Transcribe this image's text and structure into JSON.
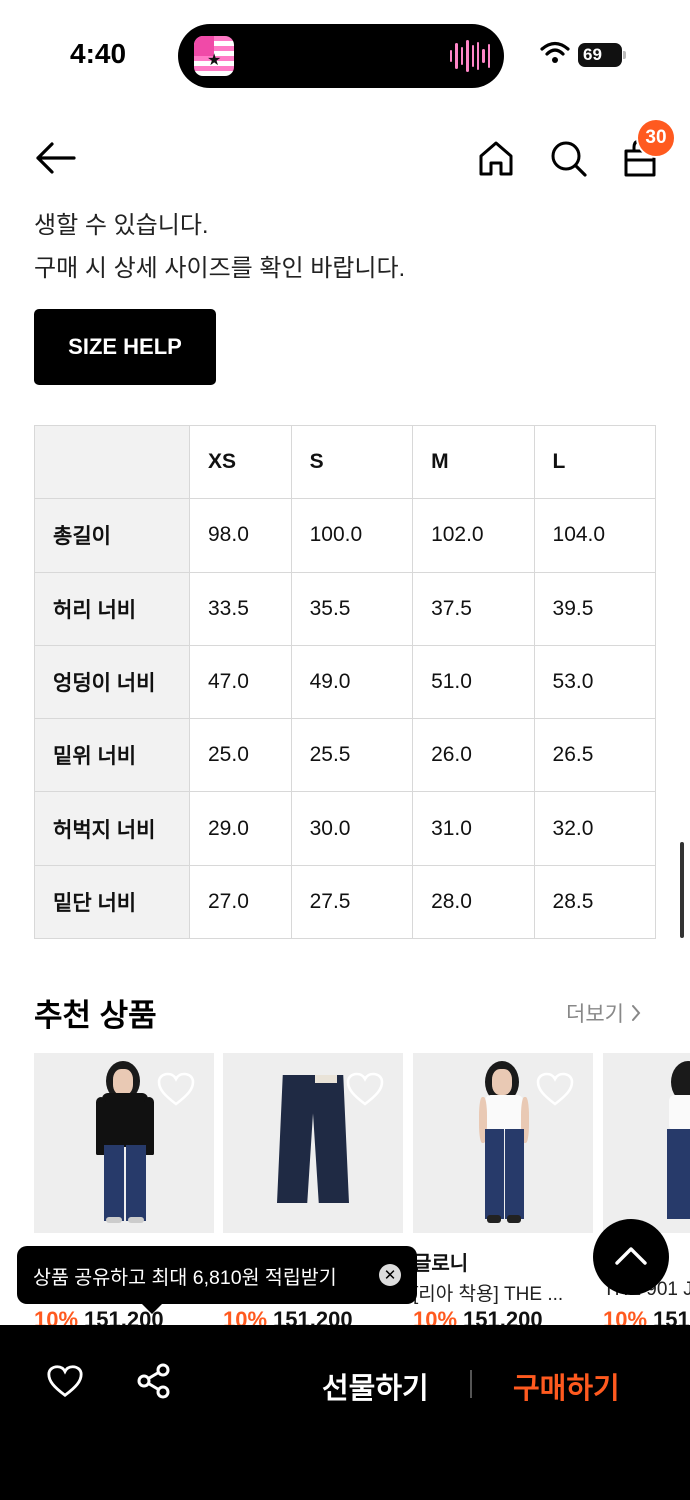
{
  "status_bar": {
    "time": "4:40",
    "battery": "69"
  },
  "nav": {
    "cart_count": "30"
  },
  "notes": {
    "line1": "생할 수 있습니다.",
    "line2": "구매 시 상세 사이즈를 확인 바랍니다."
  },
  "size_help_label": "SIZE HELP",
  "size_table": {
    "headers": [
      "",
      "XS",
      "S",
      "M",
      "L"
    ],
    "rows": [
      {
        "label": "총길이",
        "values": [
          "98.0",
          "100.0",
          "102.0",
          "104.0"
        ]
      },
      {
        "label": "허리 너비",
        "values": [
          "33.5",
          "35.5",
          "37.5",
          "39.5"
        ]
      },
      {
        "label": "엉덩이 너비",
        "values": [
          "47.0",
          "49.0",
          "51.0",
          "53.0"
        ]
      },
      {
        "label": "밑위 너비",
        "values": [
          "25.0",
          "25.5",
          "26.0",
          "26.5"
        ]
      },
      {
        "label": "허벅지 너비",
        "values": [
          "29.0",
          "30.0",
          "31.0",
          "32.0"
        ]
      },
      {
        "label": "밑단 너비",
        "values": [
          "27.0",
          "27.5",
          "28.0",
          "28.5"
        ]
      }
    ]
  },
  "recommended": {
    "title": "추천 상품",
    "more_label": "더보기",
    "products": [
      {
        "brand": "",
        "name": "",
        "discount": "10%",
        "price": "151,200"
      },
      {
        "brand": "",
        "name": "",
        "discount": "10%",
        "price": "151,200"
      },
      {
        "brand": "글로니",
        "name": "[리아 착용] THE ...",
        "discount": "10%",
        "price": "151,200"
      },
      {
        "brand": "",
        "name": "THE 901 J",
        "discount": "10%",
        "price": "151"
      }
    ]
  },
  "toast": {
    "text": "상품 공유하고 최대 6,810원 적립받기",
    "close_icon": "close-icon"
  },
  "bottom_bar": {
    "gift_label": "선물하기",
    "buy_label": "구매하기"
  },
  "colors": {
    "accent": "#ff5a1f",
    "dark": "#000000",
    "table_header_bg": "#f2f2f2"
  }
}
